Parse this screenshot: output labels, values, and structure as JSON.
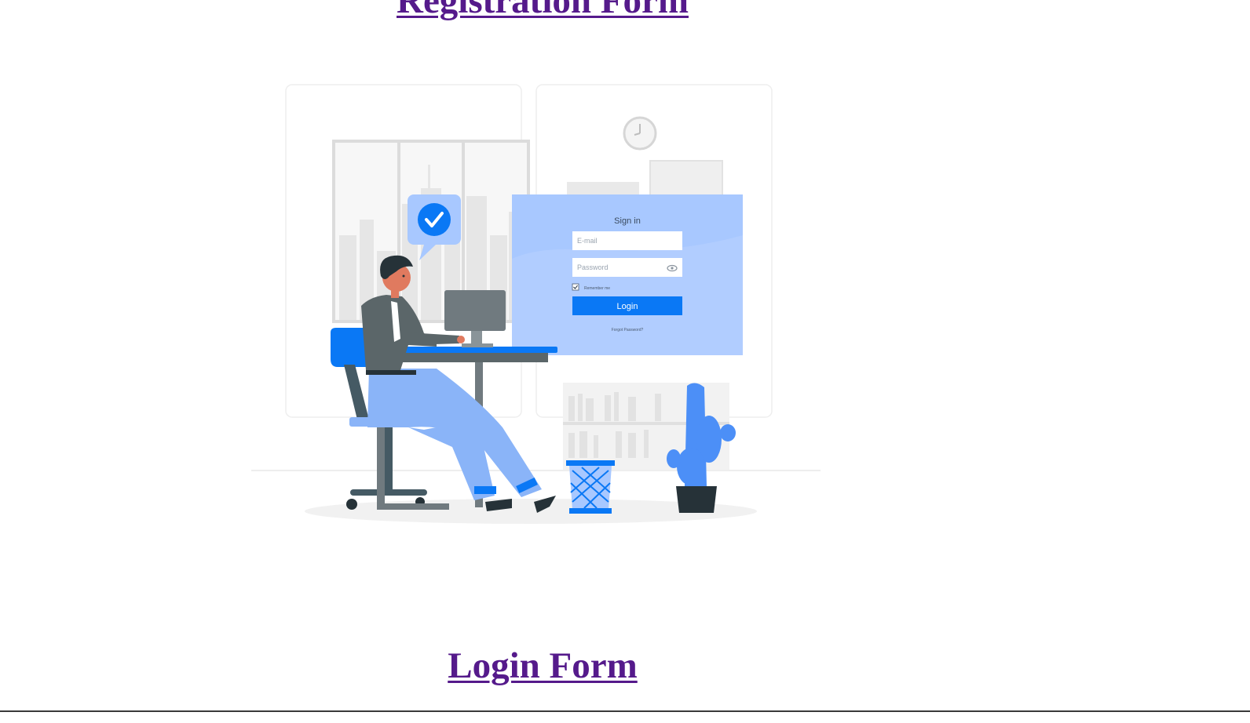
{
  "links": {
    "registration": "Registration Form",
    "login": "Login Form"
  },
  "illustration": {
    "signin_title": "Sign in",
    "email_placeholder": "E-mail",
    "password_placeholder": "Password",
    "remember_label": "Remember me",
    "login_button": "Login",
    "forgot_label": "Forgot Password?"
  },
  "colors": {
    "link": "#551a8b",
    "accent": "#0a78f5",
    "panel": "#a8c8ff",
    "pants": "#8ab4f8",
    "dark": "#2b3237",
    "grey": "#707a7f"
  }
}
